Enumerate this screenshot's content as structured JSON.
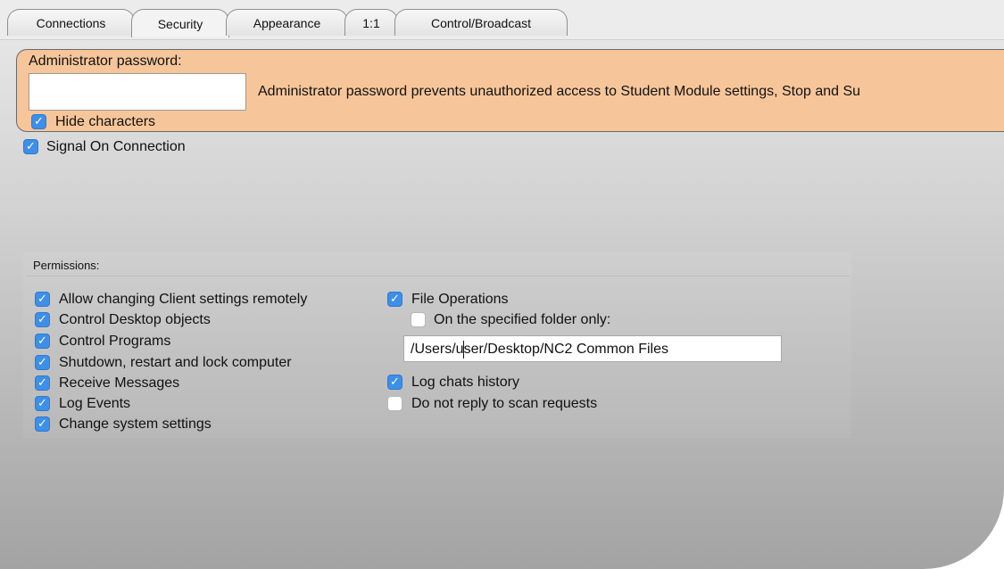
{
  "tabs": [
    {
      "label": "Connections",
      "active": false
    },
    {
      "label": "Security",
      "active": true
    },
    {
      "label": "Appearance",
      "active": false
    },
    {
      "label": "1:1",
      "active": false
    },
    {
      "label": "Control/Broadcast",
      "active": false
    }
  ],
  "security": {
    "admin_password_label": "Administrator password:",
    "admin_password_value": "",
    "admin_password_help": "Administrator password prevents unauthorized access to Student Module settings, Stop and Su",
    "hide_characters": {
      "label": "Hide characters",
      "checked": true
    },
    "signal_on_connection": {
      "label": "Signal On Connection",
      "checked": true
    }
  },
  "permissions": {
    "title": "Permissions:",
    "left": [
      {
        "label": "Allow changing Client settings remotely",
        "checked": true
      },
      {
        "label": "Control Desktop objects",
        "checked": true
      },
      {
        "label": "Control Programs",
        "checked": true
      },
      {
        "label": "Shutdown, restart and lock computer",
        "checked": true
      },
      {
        "label": "Receive Messages",
        "checked": true
      },
      {
        "label": "Log Events",
        "checked": true
      },
      {
        "label": "Change system settings",
        "checked": true
      }
    ],
    "file_operations": {
      "label": "File Operations",
      "checked": true
    },
    "specified_folder_only": {
      "label": "On the specified folder only:",
      "checked": false
    },
    "folder_path": "/Users/user/Desktop/NC2 Common Files",
    "log_chats_history": {
      "label": "Log chats history",
      "checked": true
    },
    "no_scan_reply": {
      "label": "Do not reply to scan requests",
      "checked": false
    }
  },
  "colors": {
    "accent": "#3d8fe8",
    "orange_panel": "#f6c69a"
  }
}
